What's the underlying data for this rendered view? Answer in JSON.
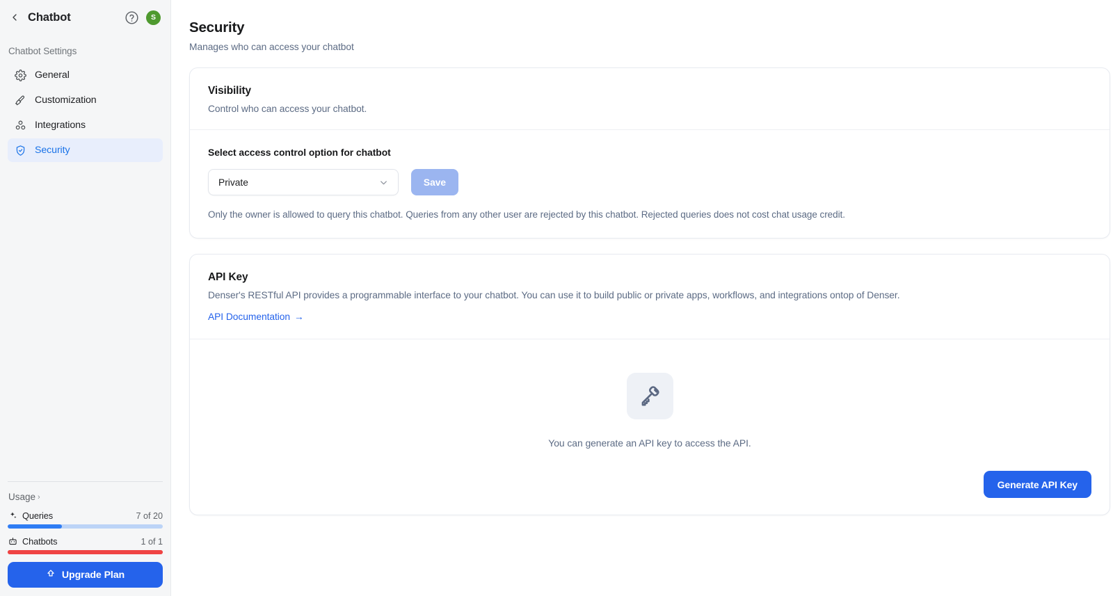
{
  "sidebar": {
    "title": "Chatbot",
    "back_icon": "chevron-left-icon",
    "help_icon": "question-circle-icon",
    "avatar_initial": "S",
    "avatar_color": "#4f9a2f",
    "section_label": "Chatbot Settings",
    "items": [
      {
        "label": "General",
        "icon": "gear-icon",
        "active": false
      },
      {
        "label": "Customization",
        "icon": "paintbrush-icon",
        "active": false
      },
      {
        "label": "Integrations",
        "icon": "integrations-icon",
        "active": false
      },
      {
        "label": "Security",
        "icon": "shield-check-icon",
        "active": true
      }
    ],
    "usage": {
      "title": "Usage",
      "chevron": "›",
      "rows": [
        {
          "name": "Queries",
          "icon": "sparkle-icon",
          "value": "7 of 20",
          "percent": 35,
          "color": "#2f7df4",
          "track": "#bcd4f7"
        },
        {
          "name": "Chatbots",
          "icon": "robot-icon",
          "value": "1 of 1",
          "percent": 100,
          "color": "#ef4444",
          "track": "#ef4444"
        }
      ]
    },
    "upgrade_label": "Upgrade Plan",
    "upgrade_icon": "arrow-up-icon"
  },
  "main": {
    "page_title": "Security",
    "page_subtitle": "Manages who can access your chatbot",
    "visibility_card": {
      "title": "Visibility",
      "description": "Control who can access your chatbot.",
      "field_label": "Select access control option for chatbot",
      "select_value": "Private",
      "select_options": [
        "Private"
      ],
      "save_label": "Save",
      "hint": "Only the owner is allowed to query this chatbot. Queries from any other user are rejected by this chatbot. Rejected queries does not cost chat usage credit."
    },
    "api_card": {
      "title": "API Key",
      "description": "Denser's RESTful API provides a programmable interface to your chatbot. You can use it to build public or private apps, workflows, and integrations ontop of Denser.",
      "doc_link_label": "API Documentation",
      "doc_link_arrow": "→",
      "empty_icon": "key-icon",
      "empty_text": "You can generate an API key to access the API.",
      "generate_label": "Generate API Key"
    }
  },
  "colors": {
    "accent": "#2563eb",
    "active_nav": "#1a73e8",
    "active_nav_bg": "#e8eefc",
    "save_disabled": "#9bb5f0",
    "danger": "#ef4444"
  }
}
